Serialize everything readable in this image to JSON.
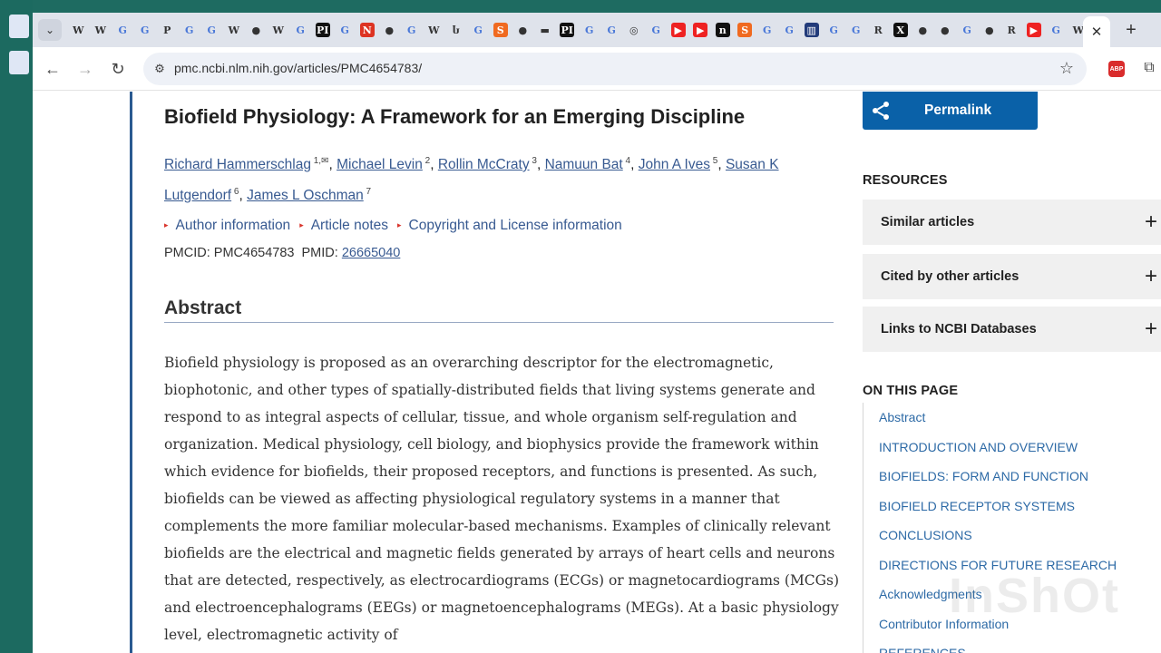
{
  "browser": {
    "url": "pmc.ncbi.nlm.nih.gov/articles/PMC4654783/",
    "tab_favicons": [
      "W",
      "W",
      "G",
      "G",
      "P",
      "G",
      "G",
      "W",
      "●",
      "W",
      "G",
      "PI",
      "G",
      "N",
      "●",
      "G",
      "W",
      "Ⴑ",
      "G",
      "S",
      "●",
      "▬",
      "PI",
      "G",
      "G",
      "◎",
      "G",
      "▶",
      "▶",
      "n",
      "S",
      "G",
      "G",
      "▥",
      "G",
      "G",
      "R",
      "X",
      "●",
      "●",
      "G",
      "●",
      "R",
      "▶",
      "G",
      "W"
    ],
    "close_glyph": "✕",
    "new_tab_glyph": "+",
    "ext_abp_label": "ABP"
  },
  "article": {
    "title": "Biofield Physiology: A Framework for an Emerging Discipline",
    "authors": [
      {
        "name": "Richard Hammerschlag",
        "sup": "1,✉"
      },
      {
        "name": "Michael Levin",
        "sup": "2"
      },
      {
        "name": "Rollin McCraty",
        "sup": "3"
      },
      {
        "name": "Namuun Bat",
        "sup": "4"
      },
      {
        "name": "John A Ives",
        "sup": "5"
      },
      {
        "name": "Susan K Lutgendorf",
        "sup": "6"
      },
      {
        "name": "James L Oschman",
        "sup": "7"
      }
    ],
    "meta_links": [
      "Author information",
      "Article notes",
      "Copyright and License information"
    ],
    "pmcid_label": "PMCID: PMC4654783",
    "pmid_label": "PMID:",
    "pmid_value": "26665040",
    "abstract_heading": "Abstract",
    "abstract_text": "Biofield physiology is proposed as an overarching descriptor for the electromagnetic, biophotonic, and other types of spatially-distributed fields that living systems generate and respond to as integral aspects of cellular, tissue, and whole organism self-regulation and organization. Medical physiology, cell biology, and biophysics provide the framework within which evidence for biofields, their proposed receptors, and functions is presented. As such, biofields can be viewed as affecting physiological regulatory systems in a manner that complements the more familiar molecular-based mechanisms. Examples of clinically relevant biofields are the electrical and magnetic fields generated by arrays of heart cells and neurons that are detected, respectively, as electrocardiograms (ECGs) or magnetocardiograms (MCGs) and electroencephalograms (EEGs) or magnetoencephalograms (MEGs). At a basic physiology level, electromagnetic activity of"
  },
  "sidebar": {
    "permalink_label": "Permalink",
    "resources_heading": "RESOURCES",
    "accordions": [
      "Similar articles",
      "Cited by other articles",
      "Links to NCBI Databases"
    ],
    "on_this_page_heading": "ON THIS PAGE",
    "toc": [
      "Abstract",
      "INTRODUCTION AND OVERVIEW",
      "BIOFIELDS: FORM AND FUNCTION",
      "BIOFIELD RECEPTOR SYSTEMS",
      "CONCLUSIONS",
      "DIRECTIONS FOR FUTURE RESEARCH",
      "Acknowledgments",
      "Contributor Information",
      "REFERENCES"
    ]
  },
  "watermark": "InShOt",
  "colors": {
    "link": "#385a91",
    "accent_blue": "#0a61a8",
    "arrow_red": "#d9352c"
  }
}
